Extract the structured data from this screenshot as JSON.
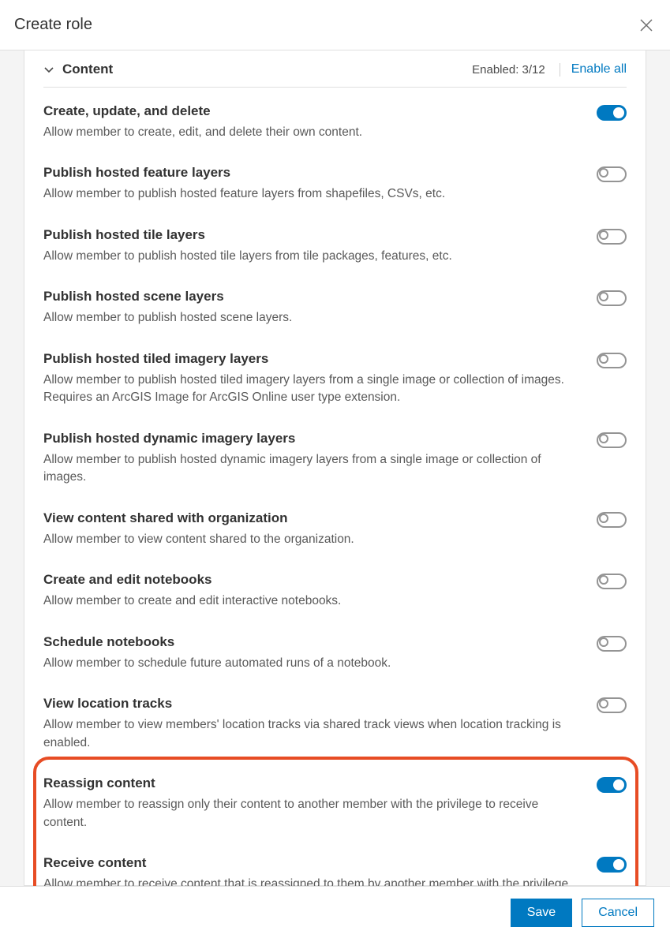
{
  "dialog": {
    "title": "Create role"
  },
  "section": {
    "title": "Content",
    "enabled_label": "Enabled: 3/12",
    "enable_all": "Enable all"
  },
  "privileges": [
    {
      "title": "Create, update, and delete",
      "desc": "Allow member to create, edit, and delete their own content.",
      "on": true
    },
    {
      "title": "Publish hosted feature layers",
      "desc": "Allow member to publish hosted feature layers from shapefiles, CSVs, etc.",
      "on": false
    },
    {
      "title": "Publish hosted tile layers",
      "desc": "Allow member to publish hosted tile layers from tile packages, features, etc.",
      "on": false
    },
    {
      "title": "Publish hosted scene layers",
      "desc": "Allow member to publish hosted scene layers.",
      "on": false
    },
    {
      "title": "Publish hosted tiled imagery layers",
      "desc": "Allow member to publish hosted tiled imagery layers from a single image or collection of images. Requires an ArcGIS Image for ArcGIS Online user type extension.",
      "on": false
    },
    {
      "title": "Publish hosted dynamic imagery layers",
      "desc": "Allow member to publish hosted dynamic imagery layers from a single image or collection of images.",
      "on": false
    },
    {
      "title": "View content shared with organization",
      "desc": "Allow member to view content shared to the organization.",
      "on": false
    },
    {
      "title": "Create and edit notebooks",
      "desc": "Allow member to create and edit interactive notebooks.",
      "on": false
    },
    {
      "title": "Schedule notebooks",
      "desc": "Allow member to schedule future automated runs of a notebook.",
      "on": false
    },
    {
      "title": "View location tracks",
      "desc": "Allow member to view members' location tracks via shared track views when location tracking is enabled.",
      "on": false
    },
    {
      "title": "Reassign content",
      "desc": "Allow member to reassign only their content to another member with the privilege to receive content.",
      "on": true
    },
    {
      "title": "Receive content",
      "desc": "Allow member to receive content that is reassigned to them by another member with the privilege to reassign content.",
      "on": true
    }
  ],
  "footer": {
    "save": "Save",
    "cancel": "Cancel"
  }
}
